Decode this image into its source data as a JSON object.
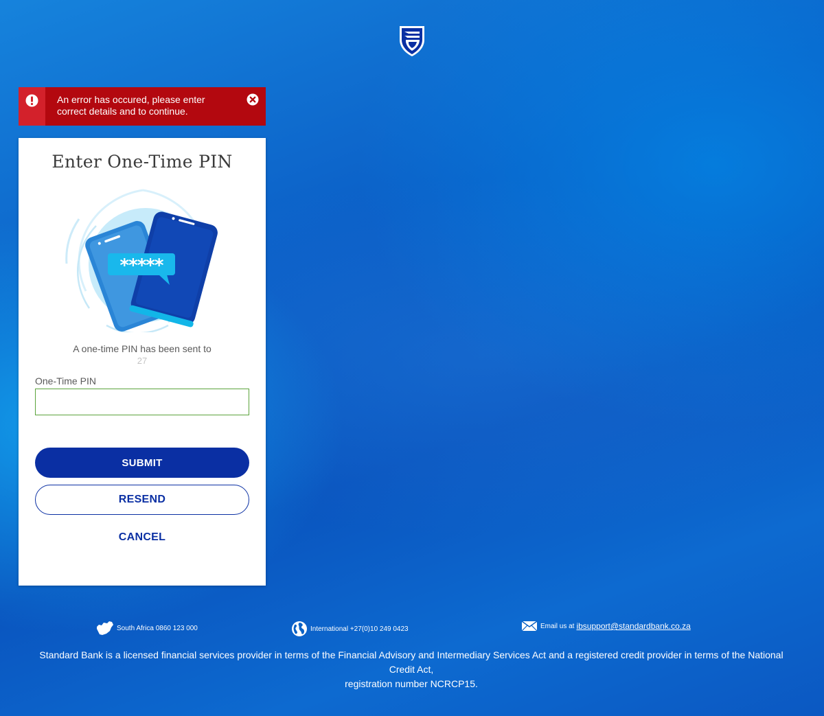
{
  "brand": {
    "logo_icon": "standard-bank-shield-icon"
  },
  "error": {
    "message": "An error has occured, please enter correct details and to continue.",
    "icon": "exclamation-icon",
    "close_icon": "close-circle-icon",
    "color": "#b3080f"
  },
  "otp": {
    "title": "Enter One-Time PIN",
    "illustration_icon": "phones-otp-illustration",
    "sent_text": "A one-time PIN has been sent to",
    "sent_number": "27",
    "field_label": "One-Time PIN",
    "field_value": "",
    "submit_label": "SUBMIT",
    "resend_label": "RESEND",
    "cancel_label": "CANCEL",
    "accent_color": "#0a2fa3"
  },
  "footer": {
    "south_africa": {
      "icon": "south-africa-map-icon",
      "text": "South Africa 0860 123 000"
    },
    "international": {
      "icon": "globe-icon",
      "text": "International +27(0)10 249 0423"
    },
    "email": {
      "icon": "envelope-icon",
      "prefix": "Email us at",
      "address": "ibsupport@standardbank.co.za"
    },
    "legal_line1": "Standard Bank is a licensed financial services provider in terms of the Financial Advisory and Intermediary Services Act and a registered credit provider in terms of the National Credit Act,",
    "legal_line2": "registration number NCRCP15."
  }
}
